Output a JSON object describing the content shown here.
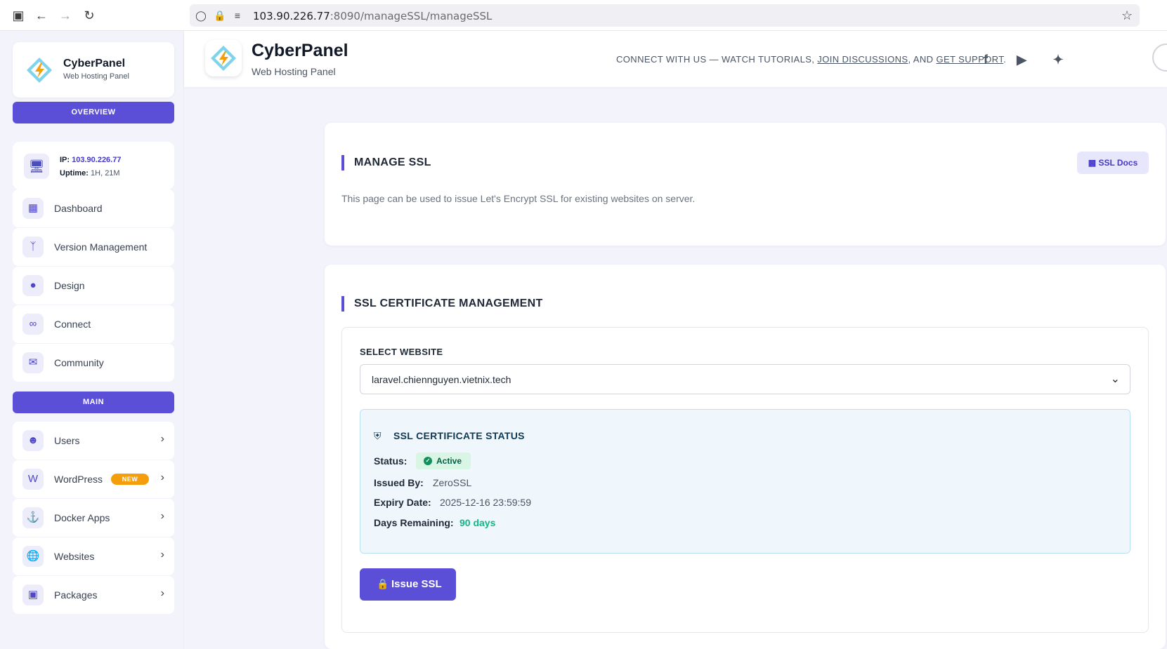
{
  "browser": {
    "url_host": "103.90.226.77",
    "url_rest": ":8090/manageSSL/manageSSL"
  },
  "sidebar": {
    "brand_title": "CyberPanel",
    "brand_sub": "Web Hosting Panel",
    "overview_label": "OVERVIEW",
    "ip_label": "IP:",
    "ip_value": "103.90.226.77",
    "uptime_label": "Uptime:",
    "uptime_value": "1H, 21M",
    "overview_items": [
      {
        "label": "Dashboard",
        "icon": "grid-icon"
      },
      {
        "label": "Version Management",
        "icon": "branch-icon"
      },
      {
        "label": "Design",
        "icon": "palette-icon"
      },
      {
        "label": "Connect",
        "icon": "link-icon"
      },
      {
        "label": "Community",
        "icon": "chat-icon"
      }
    ],
    "main_label": "MAIN",
    "main_items": [
      {
        "label": "Users",
        "icon": "users-icon"
      },
      {
        "label": "WordPress",
        "icon": "wordpress-icon",
        "badge": "NEW"
      },
      {
        "label": "Docker Apps",
        "icon": "ship-icon"
      },
      {
        "label": "Websites",
        "icon": "globe-icon"
      },
      {
        "label": "Packages",
        "icon": "box-icon"
      }
    ]
  },
  "header": {
    "title": "CyberPanel",
    "subtitle": "Web Hosting Panel",
    "connect_prefix": "CONNECT WITH US — WATCH TUTORIALS, ",
    "join_link": "JOIN DISCUSSIONS",
    "connect_mid": ", AND ",
    "support_link": "GET SUPPORT",
    "connect_suffix": "."
  },
  "manage": {
    "title": "MANAGE SSL",
    "docs_label": "SSL Docs",
    "description": "This page can be used to issue Let's Encrypt SSL for existing websites on server."
  },
  "cert": {
    "title": "SSL CERTIFICATE MANAGEMENT",
    "select_label": "SELECT WEBSITE",
    "selected_website": "laravel.chiennguyen.vietnix.tech",
    "status_title": "SSL CERTIFICATE STATUS",
    "status_label": "Status:",
    "status_value": "Active",
    "issued_label": "Issued By:",
    "issued_value": "ZeroSSL",
    "expiry_label": "Expiry Date:",
    "expiry_value": "2025-12-16 23:59:59",
    "days_label": "Days Remaining:",
    "days_value": "90 days",
    "issue_button": "Issue SSL"
  }
}
